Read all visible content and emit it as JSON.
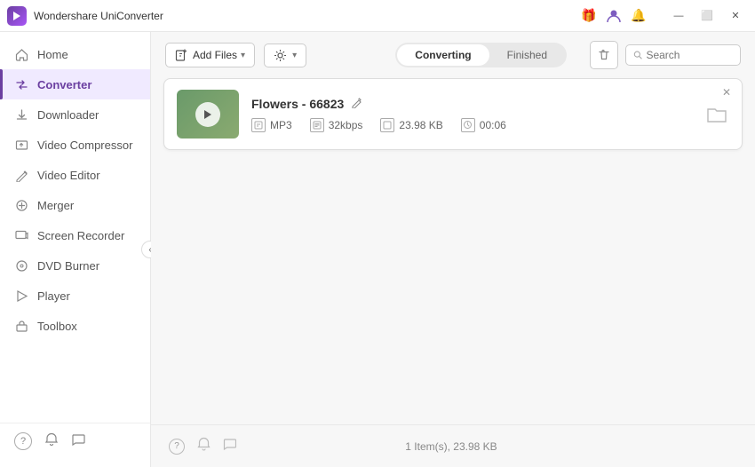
{
  "app": {
    "title": "Wondershare UniConverter",
    "logo_alt": "Wondershare logo"
  },
  "titlebar": {
    "icons": {
      "gift": "🎁",
      "user": "👤",
      "bell": "🔔"
    },
    "controls": {
      "minimize": "—",
      "restore": "⬜",
      "close": "✕"
    }
  },
  "sidebar": {
    "items": [
      {
        "id": "home",
        "label": "Home",
        "icon": "⌂"
      },
      {
        "id": "converter",
        "label": "Converter",
        "icon": "⇄",
        "active": true
      },
      {
        "id": "downloader",
        "label": "Downloader",
        "icon": "⬇"
      },
      {
        "id": "video-compressor",
        "label": "Video Compressor",
        "icon": "⊡"
      },
      {
        "id": "video-editor",
        "label": "Video Editor",
        "icon": "✂"
      },
      {
        "id": "merger",
        "label": "Merger",
        "icon": "⊕"
      },
      {
        "id": "screen-recorder",
        "label": "Screen Recorder",
        "icon": "▣"
      },
      {
        "id": "dvd-burner",
        "label": "DVD Burner",
        "icon": "⊙"
      },
      {
        "id": "player",
        "label": "Player",
        "icon": "▶"
      },
      {
        "id": "toolbox",
        "label": "Toolbox",
        "icon": "⚙"
      }
    ],
    "bottom_items": [
      {
        "id": "help",
        "icon": "?"
      },
      {
        "id": "notification",
        "icon": "🔔"
      },
      {
        "id": "feedback",
        "icon": "💬"
      }
    ],
    "collapse_icon": "‹"
  },
  "toolbar": {
    "add_button_label": "+",
    "add_button_dropdown": "▾",
    "settings_icon": "⚙",
    "settings_dropdown": "▾"
  },
  "tabs": {
    "items": [
      {
        "id": "converting",
        "label": "Converting",
        "active": true
      },
      {
        "id": "finished",
        "label": "Finished",
        "active": false
      }
    ]
  },
  "search": {
    "placeholder": "Search",
    "icon": "🔍"
  },
  "file_card": {
    "name": "Flowers - 66823",
    "edit_icon": "✎",
    "close_icon": "✕",
    "folder_icon": "🗁",
    "meta": [
      {
        "id": "format",
        "icon": "▣",
        "value": "MP3"
      },
      {
        "id": "bitrate",
        "icon": "▤",
        "value": "32kbps"
      },
      {
        "id": "size",
        "icon": "▢",
        "value": "23.98 KB"
      },
      {
        "id": "duration",
        "icon": "⏱",
        "value": "00:06"
      }
    ],
    "thumbnail_alt": "file thumbnail"
  },
  "bottom": {
    "status": "1 Item(s), 23.98 KB",
    "icons": {
      "help": "?",
      "bell": "🔔",
      "chat": "💬"
    }
  }
}
